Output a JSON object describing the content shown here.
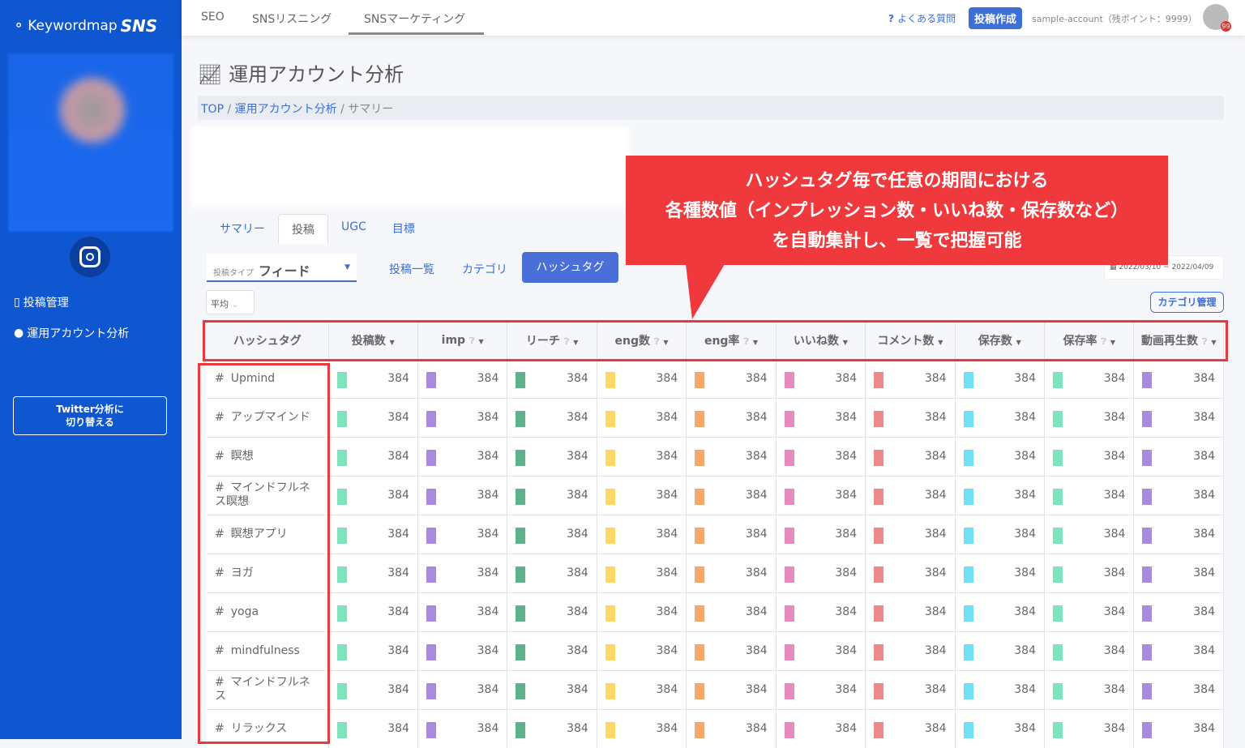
{
  "brand": {
    "name": "Keywordmap",
    "suffix": "SNS"
  },
  "sidebar": {
    "items": [
      {
        "label": "投稿管理",
        "icon": "tablet-icon"
      },
      {
        "label": "運用アカウント分析",
        "icon": "user-circle-icon"
      }
    ],
    "switch_label_1": "Twitter分析に",
    "switch_label_2": "切り替える"
  },
  "topnav": {
    "tabs": [
      "SEO",
      "SNSリスニング",
      "SNSマーケティング"
    ],
    "faq": "よくある質問",
    "post": "投稿作成",
    "account": "sample-account（残ポイント：9999）",
    "badge": "99"
  },
  "page": {
    "title": "運用アカウント分析",
    "breadcrumb": [
      "TOP",
      "運用アカウント分析",
      "サマリー"
    ]
  },
  "tabs": [
    "サマリー",
    "投稿",
    "UGC",
    "目標"
  ],
  "filters": {
    "post_type_label": "投稿タイプ",
    "post_type_value": "フィード",
    "links": [
      "投稿一覧",
      "カテゴリ"
    ],
    "active": "ハッシュタグ",
    "aggregate": "平均",
    "date_range": "2022/03/10 ~ 2022/04/09",
    "category_manage": "カテゴリ管理"
  },
  "callout": [
    "ハッシュタグ毎で任意の期間における",
    "各種数値（インプレッション数・いいね数・保存数など）",
    "を自動集計し、一覧で把握可能"
  ],
  "table": {
    "columns": [
      {
        "label": "ハッシュタグ"
      },
      {
        "label": "投稿数",
        "help": false
      },
      {
        "label": "imp",
        "help": true
      },
      {
        "label": "リーチ",
        "help": true
      },
      {
        "label": "eng数",
        "help": true
      },
      {
        "label": "eng率",
        "help": true
      },
      {
        "label": "いいね数",
        "help": false
      },
      {
        "label": "コメント数",
        "help": false
      },
      {
        "label": "保存数",
        "help": false
      },
      {
        "label": "保存率",
        "help": true
      },
      {
        "label": "動画再生数",
        "help": true
      }
    ],
    "bar_colors": [
      "#7fe3bd",
      "#a98ce0",
      "#5fb38a",
      "#fbd966",
      "#f7a86a",
      "#e88ac0",
      "#ec8a8a",
      "#70e0f7",
      "#7fe3bd",
      "#a98ce0"
    ],
    "rows": [
      {
        "tag": "Upmind",
        "values": [
          "384",
          "384",
          "384",
          "384",
          "384",
          "384",
          "384",
          "384",
          "384",
          "384"
        ]
      },
      {
        "tag": "アップマインド",
        "values": [
          "384",
          "384",
          "384",
          "384",
          "384",
          "384",
          "384",
          "384",
          "384",
          "384"
        ]
      },
      {
        "tag": "瞑想",
        "values": [
          "384",
          "384",
          "384",
          "384",
          "384",
          "384",
          "384",
          "384",
          "384",
          "384"
        ]
      },
      {
        "tag": "マインドフルネス瞑想",
        "values": [
          "384",
          "384",
          "384",
          "384",
          "384",
          "384",
          "384",
          "384",
          "384",
          "384"
        ]
      },
      {
        "tag": "瞑想アプリ",
        "values": [
          "384",
          "384",
          "384",
          "384",
          "384",
          "384",
          "384",
          "384",
          "384",
          "384"
        ]
      },
      {
        "tag": "ヨガ",
        "values": [
          "384",
          "384",
          "384",
          "384",
          "384",
          "384",
          "384",
          "384",
          "384",
          "384"
        ]
      },
      {
        "tag": "yoga",
        "values": [
          "384",
          "384",
          "384",
          "384",
          "384",
          "384",
          "384",
          "384",
          "384",
          "384"
        ]
      },
      {
        "tag": "mindfulness",
        "values": [
          "384",
          "384",
          "384",
          "384",
          "384",
          "384",
          "384",
          "384",
          "384",
          "384"
        ]
      },
      {
        "tag": "マインドフルネス",
        "values": [
          "384",
          "384",
          "384",
          "384",
          "384",
          "384",
          "384",
          "384",
          "384",
          "384"
        ]
      },
      {
        "tag": "リラックス",
        "values": [
          "384",
          "384",
          "384",
          "384",
          "384",
          "384",
          "384",
          "384",
          "384",
          "384"
        ]
      }
    ]
  }
}
